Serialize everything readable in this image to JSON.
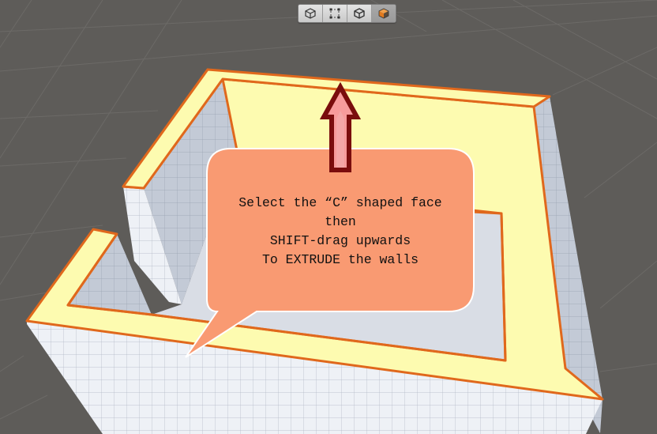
{
  "toolbar": {
    "tools": [
      {
        "name": "object-mode-tool",
        "icon": "cube-outline-icon",
        "active": false
      },
      {
        "name": "vertex-mode-tool",
        "icon": "vertex-select-icon",
        "active": false
      },
      {
        "name": "edge-mode-tool",
        "icon": "cube-edge-icon",
        "active": false
      },
      {
        "name": "face-mode-tool",
        "icon": "cube-face-icon",
        "active": true
      }
    ]
  },
  "callout": {
    "line1": "Select the “C” shaped face",
    "line2": "then",
    "line3": "SHIFT-drag upwards",
    "line4": "To EXTRUDE the walls",
    "fill": "#f99a72"
  },
  "colors": {
    "background": "#5e5c59",
    "selected_face": "#fdfbb0",
    "selection_outline": "#e0681c",
    "arrow": "#7a0d0d"
  }
}
